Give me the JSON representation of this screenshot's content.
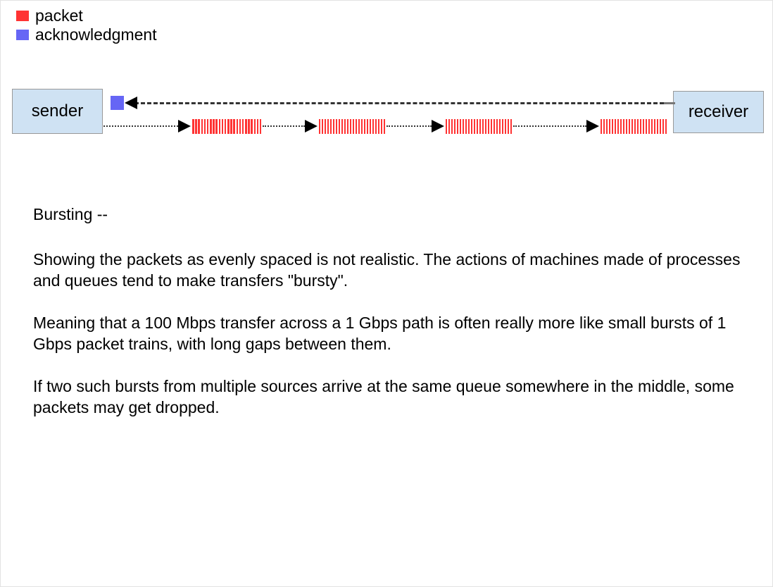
{
  "legend": {
    "items": [
      {
        "label": "packet",
        "color": "#ff3333",
        "icon": "packet-swatch"
      },
      {
        "label": "acknowledgment",
        "color": "#6666f5",
        "icon": "acknowledgment-swatch"
      }
    ]
  },
  "diagram": {
    "sender_label": "sender",
    "receiver_label": "receiver",
    "packet_color": "#ff3333",
    "ack_color": "#6666f5",
    "box_fill": "#cfe2f3",
    "box_border": "#999999",
    "line_color": "#333333",
    "ack_count": 1,
    "packet_train_count": 4,
    "bars_per_train": 24
  },
  "content": {
    "heading": "Bursting --",
    "paragraphs": [
      "Showing the packets as evenly spaced is not realistic. The actions of machines made of processes and queues tend to make transfers \"bursty\".",
      "Meaning that a 100 Mbps transfer across a 1 Gbps path is often really more like small bursts of 1 Gbps packet trains, with long gaps between them.",
      "If two such bursts from multiple sources arrive at the same queue somewhere in the middle, some packets may get dropped."
    ]
  }
}
